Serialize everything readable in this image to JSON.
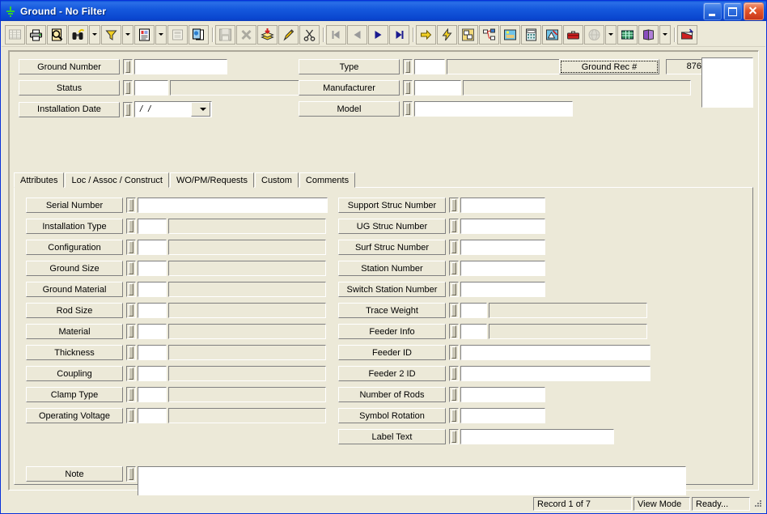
{
  "window": {
    "title": "Ground - No Filter",
    "icon": "ground-symbol-icon",
    "minimize_label": "Minimize",
    "maximize_label": "Maximize",
    "close_label": "Close"
  },
  "toolbar": {
    "groups": [
      {
        "buttons": [
          {
            "name": "grid-view-icon",
            "label": "Grid View",
            "disabled": true,
            "dropdown": false
          },
          {
            "name": "print-icon",
            "label": "Print",
            "disabled": false,
            "dropdown": false
          },
          {
            "name": "print-preview-icon",
            "label": "Print Preview",
            "disabled": false,
            "dropdown": false
          },
          {
            "name": "find-binoculars-icon",
            "label": "Find",
            "disabled": false,
            "dropdown": true
          },
          {
            "name": "filter-funnel-icon",
            "label": "Filter",
            "disabled": false,
            "dropdown": true
          },
          {
            "name": "report-icon",
            "label": "Report",
            "disabled": false,
            "dropdown": true
          },
          {
            "name": "form-properties-icon",
            "label": "Form Properties",
            "disabled": true,
            "dropdown": false
          },
          {
            "name": "copy-record-icon",
            "label": "Copy Record",
            "disabled": false,
            "dropdown": false
          }
        ]
      },
      {
        "buttons": [
          {
            "name": "save-icon",
            "label": "Save",
            "disabled": true,
            "dropdown": false
          },
          {
            "name": "delete-icon",
            "label": "Delete",
            "disabled": true,
            "dropdown": false
          },
          {
            "name": "add-record-icon",
            "label": "Add Record",
            "disabled": false,
            "dropdown": false
          },
          {
            "name": "edit-pencil-icon",
            "label": "Edit",
            "disabled": false,
            "dropdown": false
          },
          {
            "name": "cut-scissors-icon",
            "label": "Cut",
            "disabled": false,
            "dropdown": false
          }
        ]
      },
      {
        "buttons": [
          {
            "name": "first-record-icon",
            "label": "First Record",
            "disabled": true,
            "dropdown": false
          },
          {
            "name": "previous-record-icon",
            "label": "Previous Record",
            "disabled": true,
            "dropdown": false
          },
          {
            "name": "next-record-icon",
            "label": "Next Record",
            "disabled": false,
            "dropdown": false
          },
          {
            "name": "last-record-icon",
            "label": "Last Record",
            "disabled": false,
            "dropdown": false
          }
        ]
      },
      {
        "buttons": [
          {
            "name": "goto-arrow-icon",
            "label": "Go To",
            "disabled": false,
            "dropdown": false
          },
          {
            "name": "lightning-icon",
            "label": "Actions",
            "disabled": false,
            "dropdown": false
          },
          {
            "name": "associations-icon",
            "label": "Associations",
            "disabled": false,
            "dropdown": false
          },
          {
            "name": "hierarchy-icon",
            "label": "Hierarchy",
            "disabled": false,
            "dropdown": false
          },
          {
            "name": "map-image-icon",
            "label": "Map",
            "disabled": false,
            "dropdown": false
          },
          {
            "name": "calculator-icon",
            "label": "Calculator",
            "disabled": false,
            "dropdown": false
          },
          {
            "name": "design-icon",
            "label": "Design",
            "disabled": false,
            "dropdown": false
          },
          {
            "name": "toolbox-icon",
            "label": "Toolbox",
            "disabled": false,
            "dropdown": false
          },
          {
            "name": "globe-icon",
            "label": "Web",
            "disabled": true,
            "dropdown": true
          },
          {
            "name": "spreadsheet-icon",
            "label": "Export",
            "disabled": false,
            "dropdown": false
          },
          {
            "name": "help-book-icon",
            "label": "Help",
            "disabled": false,
            "dropdown": true
          },
          {
            "name": "exit-icon",
            "label": "Exit",
            "disabled": false,
            "dropdown": false
          }
        ]
      }
    ]
  },
  "header": {
    "left_fields": [
      {
        "label": "Ground Number",
        "value": "",
        "kind": "wide"
      },
      {
        "label": "Status",
        "value": "",
        "desc": "",
        "kind": "code"
      },
      {
        "label": "Installation Date",
        "value": "  /  /",
        "kind": "date"
      }
    ],
    "right_fields": [
      {
        "label": "Type",
        "value": "",
        "desc": "",
        "kind": "code"
      },
      {
        "label": "Manufacturer",
        "value": "",
        "desc": "",
        "kind": "code"
      },
      {
        "label": "Model",
        "value": "",
        "kind": "wide"
      }
    ],
    "record_id": {
      "label": "Ground Rec #",
      "value": "876"
    }
  },
  "tabs": [
    {
      "label": "Attributes",
      "active": true
    },
    {
      "label": "Loc / Assoc / Construct",
      "active": false
    },
    {
      "label": "WO/PM/Requests",
      "active": false
    },
    {
      "label": "Custom",
      "active": false
    },
    {
      "label": "Comments",
      "active": false
    }
  ],
  "attributes": {
    "left_column": [
      {
        "label": "Serial Number",
        "value": "",
        "kind": "wide"
      },
      {
        "label": "Installation Type",
        "value": "",
        "desc": "",
        "kind": "code"
      },
      {
        "label": "Configuration",
        "value": "",
        "desc": "",
        "kind": "code"
      },
      {
        "label": "Ground Size",
        "value": "",
        "desc": "",
        "kind": "code"
      },
      {
        "label": "Ground Material",
        "value": "",
        "desc": "",
        "kind": "code"
      },
      {
        "label": "Rod Size",
        "value": "",
        "desc": "",
        "kind": "code"
      },
      {
        "label": "Material",
        "value": "",
        "desc": "",
        "kind": "code"
      },
      {
        "label": "Thickness",
        "value": "",
        "desc": "",
        "kind": "code"
      },
      {
        "label": "Coupling",
        "value": "",
        "desc": "",
        "kind": "code"
      },
      {
        "label": "Clamp Type",
        "value": "",
        "desc": "",
        "kind": "code"
      },
      {
        "label": "Operating Voltage",
        "value": "",
        "desc": "",
        "kind": "code"
      }
    ],
    "right_column": [
      {
        "label": "Support Struc Number",
        "value": "",
        "kind": "medium"
      },
      {
        "label": "UG Struc Number",
        "value": "",
        "kind": "medium"
      },
      {
        "label": "Surf Struc Number",
        "value": "",
        "kind": "medium"
      },
      {
        "label": "Station Number",
        "value": "",
        "kind": "medium"
      },
      {
        "label": "Switch Station Number",
        "value": "",
        "kind": "medium"
      },
      {
        "label": "Trace Weight",
        "value": "",
        "desc": "",
        "kind": "code"
      },
      {
        "label": "Feeder Info",
        "value": "",
        "desc": "",
        "kind": "code"
      },
      {
        "label": "Feeder ID",
        "value": "",
        "kind": "wide"
      },
      {
        "label": "Feeder 2 ID",
        "value": "",
        "kind": "wide"
      },
      {
        "label": "Number of Rods",
        "value": "",
        "kind": "medium"
      },
      {
        "label": "Symbol Rotation",
        "value": "",
        "kind": "medium"
      },
      {
        "label": "Label Text",
        "value": "",
        "kind": "labeltext"
      }
    ],
    "note": {
      "label": "Note",
      "value": ""
    }
  },
  "statusbar": {
    "record_position": "Record 1 of 7",
    "mode": "View Mode",
    "state": "Ready..."
  }
}
